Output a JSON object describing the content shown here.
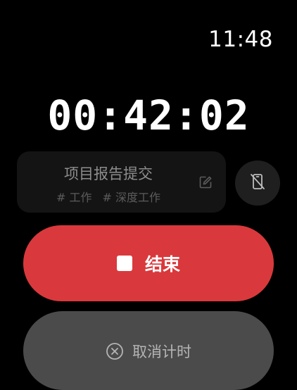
{
  "status_bar": {
    "time": "11:48"
  },
  "timer": {
    "elapsed": "00:42:02"
  },
  "task": {
    "title": "项目报告提交",
    "tags": [
      "# 工作",
      "# 深度工作"
    ]
  },
  "actions": {
    "end_label": "结束",
    "cancel_label": "取消计时"
  },
  "icons": {
    "edit": "edit-icon",
    "phone_off": "phone-off-icon",
    "stop": "stop-icon",
    "cancel": "close-circle-icon"
  },
  "colors": {
    "background": "#000000",
    "end_button": "#d9393c",
    "cancel_button": "#4b4b4b",
    "task_card": "#141414"
  }
}
